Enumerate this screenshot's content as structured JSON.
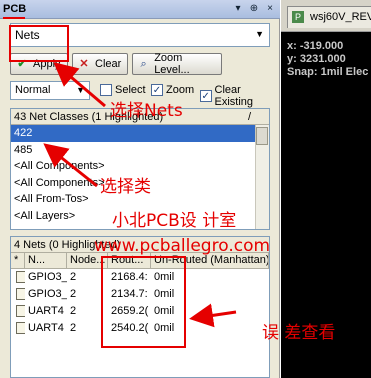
{
  "panel": {
    "title": "PCB",
    "title_buttons": [
      "▾",
      "⊕",
      "×"
    ],
    "filter": {
      "value": "Nets",
      "arrow_icon": "chevron-down-icon"
    },
    "buttons": {
      "apply": "Apply",
      "clear": "Clear",
      "zoom_level": "Zoom Level..."
    },
    "mode": "Normal",
    "checkboxes": [
      {
        "label": "Select",
        "checked": false
      },
      {
        "label": "Zoom",
        "checked": true
      },
      {
        "label": "Clear Existing",
        "checked": true
      }
    ],
    "classes": {
      "header": "43 Net Classes (1 Highlighted)",
      "sort_icon": "/",
      "items": [
        "422",
        "485",
        "<All Components>",
        "<All Components>",
        "<All From-Tos>",
        "<All Layers>"
      ],
      "selected_index": 0
    },
    "nets": {
      "header": "4 Nets (0 Highlighted)",
      "columns": [
        "*",
        "N...",
        "Node...",
        "Rout...",
        "Un-Routed (Manhattan)"
      ],
      "rows": [
        {
          "name": "GPIO3_",
          "nodes": "2",
          "routed": "2168.4:",
          "unrouted": "0mil"
        },
        {
          "name": "GPIO3_",
          "nodes": "2",
          "routed": "2134.7:",
          "unrouted": "0mil"
        },
        {
          "name": "UART4",
          "nodes": "2",
          "routed": "2659.2(",
          "unrouted": "0mil"
        },
        {
          "name": "UART4",
          "nodes": "2",
          "routed": "2540.2(",
          "unrouted": "0mil"
        }
      ]
    }
  },
  "editor": {
    "tab_label": "wsj60V_REV",
    "coord_x": "x:  -319.000",
    "coord_y": "y:  3231.000",
    "snap": "Snap: 1mil Elec"
  },
  "annotations": {
    "select_nets": "选择Nets",
    "select_class": "选择类",
    "studio": "小北PCB设 计室",
    "website": "www.pcballegro.com",
    "check_error": "误 差查看"
  },
  "colors": {
    "annotation": "#e50000",
    "selection": "#316ac5"
  }
}
